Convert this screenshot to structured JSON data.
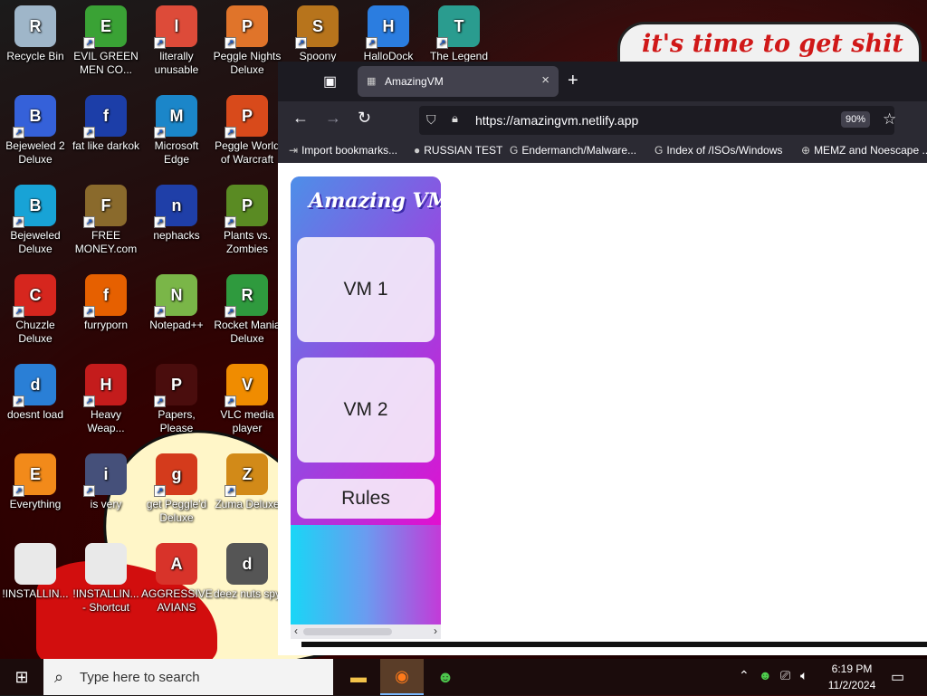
{
  "desktop": {
    "sign_text": "it's time to get shit",
    "icons": [
      {
        "label": "Recycle Bin",
        "name": "recycle-bin-icon",
        "color": "#9fb6c9"
      },
      {
        "label": "EVIL GREEN MEN CO...",
        "name": "evil-green-men-icon",
        "color": "#3aa235"
      },
      {
        "label": "literally unusable",
        "name": "chrome-icon",
        "color": "#dd4b39"
      },
      {
        "label": "Peggle Nights Deluxe",
        "name": "peggle-nights-icon",
        "color": "#e0742a"
      },
      {
        "label": "Spoony",
        "name": "spoony-icon",
        "color": "#b7741c"
      },
      {
        "label": "HalloDock",
        "name": "hallodock-icon",
        "color": "#2b7de0"
      },
      {
        "label": "The Legend",
        "name": "the-legend-icon",
        "color": "#2a9c8f"
      },
      {
        "label": "Bejeweled 2 Deluxe",
        "name": "bejeweled-2-icon",
        "color": "#3561d9"
      },
      {
        "label": "fat like darkok",
        "name": "fat-like-darkok-icon",
        "color": "#1c3ea8"
      },
      {
        "label": "Microsoft Edge",
        "name": "edge-icon",
        "color": "#1b86c9"
      },
      {
        "label": "Peggle World of Warcraft",
        "name": "peggle-warcraft-icon",
        "color": "#d84a1b"
      },
      {
        "label": "Bejeweled Deluxe",
        "name": "bejeweled-icon",
        "color": "#18a3d6"
      },
      {
        "label": "FREE MONEY.com",
        "name": "free-money-icon",
        "color": "#8a6a2c"
      },
      {
        "label": "nephacks",
        "name": "nephacks-icon",
        "color": "#1f3fa8"
      },
      {
        "label": "Plants vs. Zombies",
        "name": "plants-vs-zombies-icon",
        "color": "#5a8b23"
      },
      {
        "label": "Chuzzle Deluxe",
        "name": "chuzzle-icon",
        "color": "#d6261e"
      },
      {
        "label": "furryporn",
        "name": "firefox-icon",
        "color": "#e66000"
      },
      {
        "label": "Notepad++",
        "name": "notepad-plus-plus-icon",
        "color": "#7ab648"
      },
      {
        "label": "Rocket Mania Deluxe",
        "name": "rocket-mania-icon",
        "color": "#2f9a3e"
      },
      {
        "label": "doesnt load",
        "name": "thunderbird-icon",
        "color": "#2a7fd6"
      },
      {
        "label": "Heavy Weap...",
        "name": "heavy-weapon-icon",
        "color": "#c41c1c"
      },
      {
        "label": "Papers, Please",
        "name": "papers-please-icon",
        "color": "#4a0d0d"
      },
      {
        "label": "VLC media player",
        "name": "vlc-icon",
        "color": "#f08c00"
      },
      {
        "label": "Everything",
        "name": "everything-icon",
        "color": "#f28a1a"
      },
      {
        "label": "is very",
        "name": "is-very-icon",
        "color": "#45507a"
      },
      {
        "label": "get Peggle'd Deluxe",
        "name": "get-peggled-icon",
        "color": "#d43b1c"
      },
      {
        "label": "Zuma Deluxe",
        "name": "zuma-icon",
        "color": "#d28a18"
      },
      {
        "label": "!INSTALLIN...",
        "name": "installing-file-icon",
        "color": "#e9e9e9"
      },
      {
        "label": "!INSTALLIN... - Shortcut",
        "name": "installing-shortcut-icon",
        "color": "#e9e9e9"
      },
      {
        "label": "AGGRESSIVE AVIANS",
        "name": "angry-birds-icon",
        "color": "#d8332a"
      },
      {
        "label": "deez nuts spy",
        "name": "deez-nuts-spy-icon",
        "color": "#555555"
      }
    ]
  },
  "browser": {
    "tab_title": "AmazingVM",
    "url": "https://amazingvm.netlify.app",
    "zoom": "90%",
    "bookmarks": [
      "Import bookmarks...",
      "RUSSIAN TEST",
      "Endermanch/Malware...",
      "Index of /ISOs/Windows",
      "MEMZ and Noescape ..."
    ]
  },
  "site": {
    "brand": "Amazing VM",
    "cards": [
      "VM 1",
      "VM 2",
      "Rules"
    ]
  },
  "taskbar": {
    "search_placeholder": "Type here to search",
    "time": "6:19 PM",
    "date": "11/2/2024"
  },
  "colors": {
    "browser_chrome": "#2b2a33",
    "tab_active": "#42414d",
    "taskbar": "#1b0c0c"
  }
}
